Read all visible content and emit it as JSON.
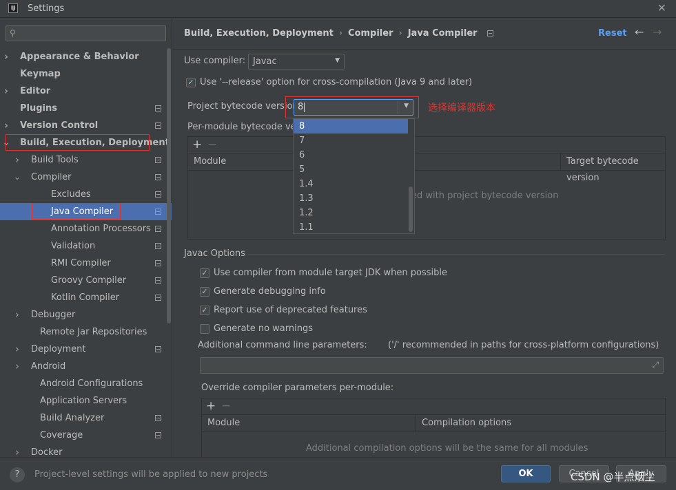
{
  "window": {
    "title": "Settings",
    "app_icon_text": "IJ"
  },
  "sidebar": {
    "search_placeholder": "",
    "items": [
      {
        "label": "Appearance & Behavior",
        "has_chevron": true,
        "expanded": false
      },
      {
        "label": "Keymap",
        "has_chevron": false
      },
      {
        "label": "Editor",
        "has_chevron": true,
        "expanded": false
      },
      {
        "label": "Plugins",
        "has_chevron": false
      },
      {
        "label": "Version Control",
        "has_chevron": true,
        "expanded": false
      },
      {
        "label": "Build, Execution, Deployment",
        "has_chevron": true,
        "expanded": true
      },
      {
        "label": "Build Tools",
        "has_chevron": true,
        "expanded": false
      },
      {
        "label": "Compiler",
        "has_chevron": true,
        "expanded": true
      },
      {
        "label": "Excludes"
      },
      {
        "label": "Java Compiler",
        "selected": true
      },
      {
        "label": "Annotation Processors"
      },
      {
        "label": "Validation"
      },
      {
        "label": "RMI Compiler"
      },
      {
        "label": "Groovy Compiler"
      },
      {
        "label": "Kotlin Compiler"
      },
      {
        "label": "Debugger",
        "has_chevron": true,
        "expanded": false
      },
      {
        "label": "Remote Jar Repositories"
      },
      {
        "label": "Deployment",
        "has_chevron": true,
        "expanded": false
      },
      {
        "label": "Android",
        "has_chevron": true,
        "expanded": false
      },
      {
        "label": "Android Configurations"
      },
      {
        "label": "Application Servers"
      },
      {
        "label": "Build Analyzer"
      },
      {
        "label": "Coverage"
      },
      {
        "label": "Docker",
        "has_chevron": true,
        "expanded": false
      }
    ]
  },
  "main": {
    "breadcrumb": [
      "Build, Execution, Deployment",
      "Java Compiler"
    ],
    "breadcrumb_mid": "Compiler",
    "reset_label": "Reset",
    "use_compiler_label": "Use compiler:",
    "use_compiler_value": "Javac",
    "release_option_label": "Use '--release' option for cross-compilation (Java 9 and later)",
    "release_option_checked": true,
    "bytecode_label": "Project bytecode version:",
    "bytecode_value": "8",
    "bytecode_options": [
      "8",
      "7",
      "6",
      "5",
      "1.4",
      "1.3",
      "1.2",
      "1.1"
    ],
    "bytecode_selected": "8",
    "annotation_text": "选择编译器版本",
    "per_module_label": "Per-module bytecode vers",
    "module_table": {
      "col_module": "Module",
      "col_target": "Target bytecode version",
      "empty_text": "ed with project bytecode version"
    },
    "javac_options_title": "Javac Options",
    "javac_options": [
      {
        "label": "Use compiler from module target JDK when possible",
        "checked": true
      },
      {
        "label": "Generate debugging info",
        "checked": true
      },
      {
        "label": "Report use of deprecated features",
        "checked": true
      },
      {
        "label": "Generate no warnings",
        "checked": false
      }
    ],
    "additional_params_label": "Additional command line parameters:",
    "additional_params_hint": "('/' recommended in paths for cross-platform configurations)",
    "additional_params_value": "",
    "override_label": "Override compiler parameters per-module:",
    "override_table": {
      "col_module": "Module",
      "col_options": "Compilation options",
      "empty_text": "Additional compilation options will be the same for all modules"
    }
  },
  "footer": {
    "help_label": "?",
    "info_text": "Project-level settings will be applied to new projects",
    "ok_label": "OK",
    "cancel_label": "Cancel",
    "apply_label": "Apply"
  },
  "watermark": "CSDN @半点烟尘",
  "colors": {
    "accent": "#4b6eaf",
    "link": "#589df6",
    "annotation": "#e0332f",
    "background": "#3c3f41"
  }
}
